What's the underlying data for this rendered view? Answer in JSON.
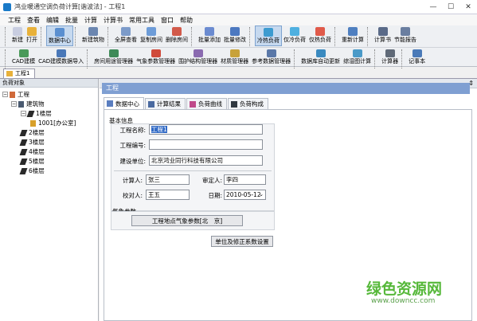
{
  "window": {
    "title": "鸿业暖通空调负荷计算[谐波法] - 工程1"
  },
  "menu": [
    "工程",
    "查看",
    "编辑",
    "批量",
    "计算",
    "计算书",
    "常用工具",
    "窗口",
    "帮助"
  ],
  "toolbar1": [
    {
      "label": "新建",
      "color": "#c8cde0"
    },
    {
      "label": "打开",
      "color": "#e8b13a"
    },
    {
      "label": "数据中心",
      "color": "#5a8fd0",
      "active": true
    },
    {
      "label": "新建筑物",
      "color": "#6b86b0"
    },
    {
      "label": "全屏查看",
      "color": "#7c9bc9"
    },
    {
      "label": "复制房间",
      "color": "#6d9cd8"
    },
    {
      "label": "删除房间",
      "color": "#d25a4a"
    },
    {
      "label": "批量添加",
      "color": "#6b8bd0"
    },
    {
      "label": "批量修改",
      "color": "#4c78c0"
    },
    {
      "label": "冷热负荷",
      "color": "#3c9bd0",
      "active": true
    },
    {
      "label": "仅冷负荷",
      "color": "#4fb0e0"
    },
    {
      "label": "仅热负荷",
      "color": "#e05a4a"
    },
    {
      "label": "重新计算",
      "color": "#4f7fc0"
    },
    {
      "label": "计算书",
      "color": "#5a6a88"
    },
    {
      "label": "节能报告",
      "color": "#6a7ea0"
    }
  ],
  "toolbar2": [
    {
      "label": "CAD建模",
      "color": "#4a9a5a"
    },
    {
      "label": "CAD建模数据导入",
      "color": "#4a78b8"
    },
    {
      "label": "房间用途管理器",
      "color": "#3e8a58"
    },
    {
      "label": "气象参数管理器",
      "color": "#d04a3a"
    },
    {
      "label": "围护结构管理器",
      "color": "#8a6ab0"
    },
    {
      "label": "材质管理器",
      "color": "#c8a23a"
    },
    {
      "label": "参考数据管理器",
      "color": "#5a78a8"
    },
    {
      "label": "数据库自动更新",
      "color": "#3a8ac0"
    },
    {
      "label": "综湿图计算",
      "color": "#4a9ac8"
    },
    {
      "label": "计算器",
      "color": "#606a78"
    },
    {
      "label": "记事本",
      "color": "#4a7ab8"
    }
  ],
  "doc_tab": {
    "label": "工程1"
  },
  "left_panel": {
    "header": "负荷对象",
    "tree": {
      "project": "工程",
      "building": "建筑物",
      "floors": [
        "1楼层",
        "2楼层",
        "3楼层",
        "4楼层",
        "5楼层",
        "6楼层"
      ],
      "room": "1001[办公室]"
    }
  },
  "right_panel": {
    "title": "工程",
    "tabs": [
      "数据中心",
      "计算结果",
      "负荷曲线",
      "负荷构成"
    ],
    "basic_info": {
      "section": "基本信息",
      "project_name_label": "工程名称:",
      "project_name": "工程1",
      "project_no_label": "工程编号:",
      "project_no": "",
      "owner_label": "建设单位:",
      "owner": "北京鸿业同行科技有限公司",
      "calc_person_label": "计算人:",
      "calc_person": "张三",
      "reviewer_label": "审定人:",
      "reviewer": "李四",
      "checker_label": "校对人:",
      "checker": "王五",
      "date_label": "日期:",
      "date": "2010-05-12"
    },
    "weather": {
      "section": "气象参数",
      "button": "工程地点气象参数[北　京]"
    },
    "correction_button": "单位及修正系数设置"
  },
  "watermark": {
    "main": "绿色资源网",
    "url": "www.downcc.com"
  }
}
